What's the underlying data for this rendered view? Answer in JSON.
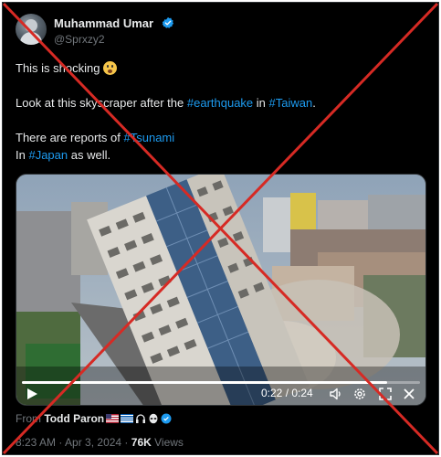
{
  "author": {
    "name": "Muhammad Umar",
    "handle": "@Sprxzy2",
    "verified": true
  },
  "tweet": {
    "line1_text": "This is shocking",
    "line1_emoji": "anxious-face-emoji",
    "line2_prefix": "Look at this skyscraper after the ",
    "line2_hashtag1": "#earthquake",
    "line2_middle": " in ",
    "line2_hashtag2": "#Taiwan",
    "line2_suffix": ".",
    "line3_prefix": "There are reports of ",
    "line3_hashtag": "#Tsunami",
    "line4_prefix": "In ",
    "line4_hashtag": "#Japan",
    "line4_suffix": " as well."
  },
  "video": {
    "time_readout": "0:22 / 0:24",
    "progress_fraction": 0.9167,
    "controls": [
      "play-icon",
      "volume-icon",
      "settings-icon",
      "fullscreen-icon",
      "close-icon"
    ]
  },
  "attribution": {
    "from_label": "From",
    "from_name": "Todd Paron",
    "badges": [
      "us-flag",
      "greek-flag",
      "headphones-icon",
      "alien-icon",
      "verified-badge"
    ]
  },
  "meta": {
    "time": "8:23 AM",
    "separator1": " · ",
    "date": "Apr 3, 2024",
    "separator2": " · ",
    "views_count": "76K",
    "views_label": " Views"
  },
  "colors": {
    "background": "#000000",
    "text": "#e7e9ea",
    "muted": "#71767b",
    "link": "#1d9bf0",
    "cross": "#d62a24"
  }
}
